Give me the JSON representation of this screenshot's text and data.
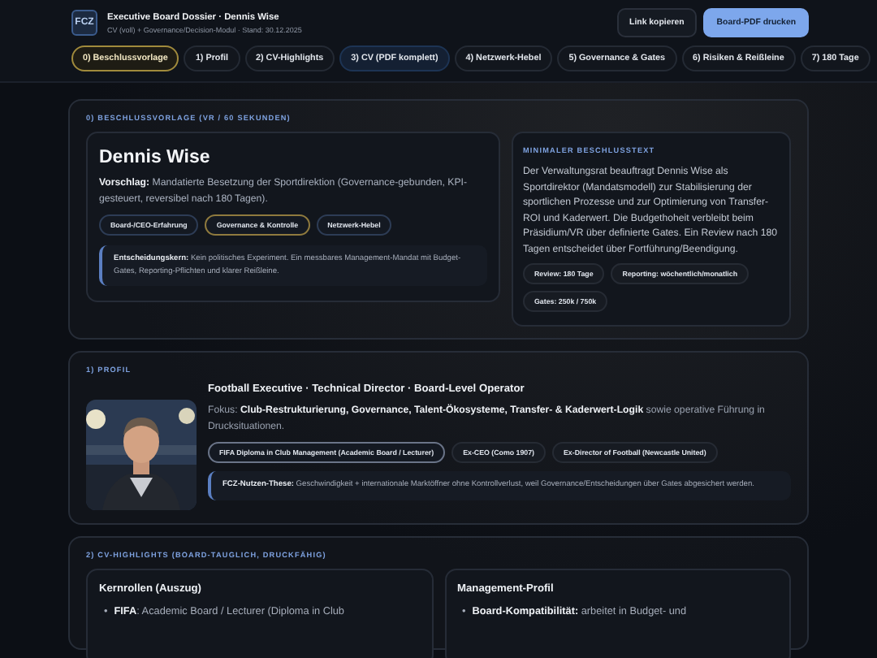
{
  "header": {
    "logo": "FCZ",
    "title": "Executive Board Dossier · Dennis Wise",
    "subtitle": "CV (voll) + Governance/Decision-Modul · Stand: 30.12.2025",
    "buttons": [
      {
        "label": "Link kopieren",
        "kind": "secondary"
      },
      {
        "label": "Board-PDF drucken",
        "kind": "primary"
      }
    ]
  },
  "tabs": [
    {
      "label": "0) Beschlussvorlage",
      "selected": true,
      "kind": "normal"
    },
    {
      "label": "1) Profil",
      "selected": false,
      "kind": "normal"
    },
    {
      "label": "2) CV-Highlights",
      "selected": false,
      "kind": "normal"
    },
    {
      "label": "3) CV (PDF komplett)",
      "selected": false,
      "kind": "highlight"
    },
    {
      "label": "4) Netzwerk-Hebel",
      "selected": false,
      "kind": "normal"
    },
    {
      "label": "5) Governance & Gates",
      "selected": false,
      "kind": "normal"
    },
    {
      "label": "6) Risiken & Reißleine",
      "selected": false,
      "kind": "normal"
    },
    {
      "label": "7) 180 Tage",
      "selected": false,
      "kind": "normal"
    }
  ],
  "decision": {
    "heading": "0) BESCHLUSSVORLAGE (VR / 60 SEKUNDEN)",
    "name": "Dennis Wise",
    "proposal": "**Vorschlag:** Mandatierte Besetzung der Sportdirektion (Governance-gebunden, KPI-gesteuert, reversibel nach 180 Tagen).",
    "chips": [
      {
        "label": "Board-/CEO-Erfahrung",
        "kind": "blue"
      },
      {
        "label": "Governance & Kontrolle",
        "kind": "gold"
      },
      {
        "label": "Netzwerk-Hebel",
        "kind": "blue"
      }
    ],
    "core": "**Entscheidungskern:** Kein politisches Experiment. Ein messbares Management-Mandat mit Budget-Gates, Reporting-Pflichten und klarer Reißleine.",
    "minimal": {
      "heading": "MINIMALER BESCHLUSSTEXT",
      "text": "Der Verwaltungsrat beauftragt Dennis Wise als Sportdirektor (Mandatsmodell) zur Stabilisierung der sportlichen Prozesse und zur Optimierung von Transfer-ROI und Kaderwert. Die Budgethoheit verbleibt beim Präsidium/VR über definierte Gates. Ein Review nach 180 Tagen entscheidet über Fortführung/Beendigung.",
      "chips": [
        {
          "label": "Review: 180 Tage",
          "kind": "plain"
        },
        {
          "label": "Reporting: wöchentlich/monatlich",
          "kind": "plain"
        },
        {
          "label": "Gates: 250k / 750k",
          "kind": "plain"
        }
      ]
    }
  },
  "profile": {
    "heading": "1) PROFIL",
    "role": "Football Executive · Technical Director · Board-Level Operator",
    "focus": "Fokus: **Club-Restrukturierung, Governance, Talent-Ökosysteme, Transfer- & Kaderwert-Logik** sowie operative Führung in Drucksituationen.",
    "chips": [
      {
        "label": "FIFA Diploma in Club Management (Academic Board / Lecturer)",
        "kind": "strong"
      },
      {
        "label": "Ex-CEO (Como 1907)",
        "kind": "plain"
      },
      {
        "label": "Ex-Director of Football (Newcastle United)",
        "kind": "plain"
      }
    ],
    "thesis": "**FCZ-Nutzen-These:** Geschwindigkeit + internationale Marktöffner ohne Kontrollverlust, weil Governance/Entscheidungen über Gates abgesichert werden."
  },
  "highlights": {
    "heading": "2) CV-HIGHLIGHTS (BOARD-TAUGLICH, DRUCKFÄHIG)",
    "cards": [
      {
        "title": "Kernrollen (Auszug)",
        "items": [
          {
            "bullet": "•",
            "text": "**FIFA**: Academic Board / Lecturer (Diploma in Club"
          }
        ]
      },
      {
        "title": "Management-Profil",
        "items": [
          {
            "bullet": "•",
            "text": "**Board-Kompatibilität:** arbeitet in Budget- und"
          }
        ]
      }
    ]
  }
}
